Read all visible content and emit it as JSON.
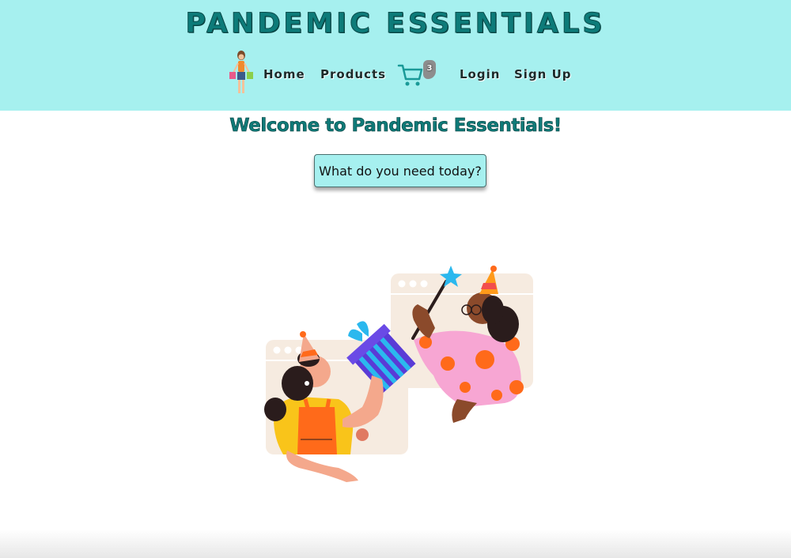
{
  "header": {
    "site_title": "PANDEMIC ESSENTIALS",
    "background_color": "#a6f0ef",
    "logo_icon": "shopping-woman-icon"
  },
  "nav": {
    "items": [
      {
        "label": "Home"
      },
      {
        "label": "Products"
      },
      {
        "label": "Login"
      },
      {
        "label": "Sign Up"
      }
    ],
    "cart": {
      "icon": "cart-icon",
      "count": "3"
    }
  },
  "main": {
    "welcome": "Welcome to Pandemic Essentials!",
    "cta_label": "What do you need today?",
    "illustration": "party-celebration-illustration"
  }
}
